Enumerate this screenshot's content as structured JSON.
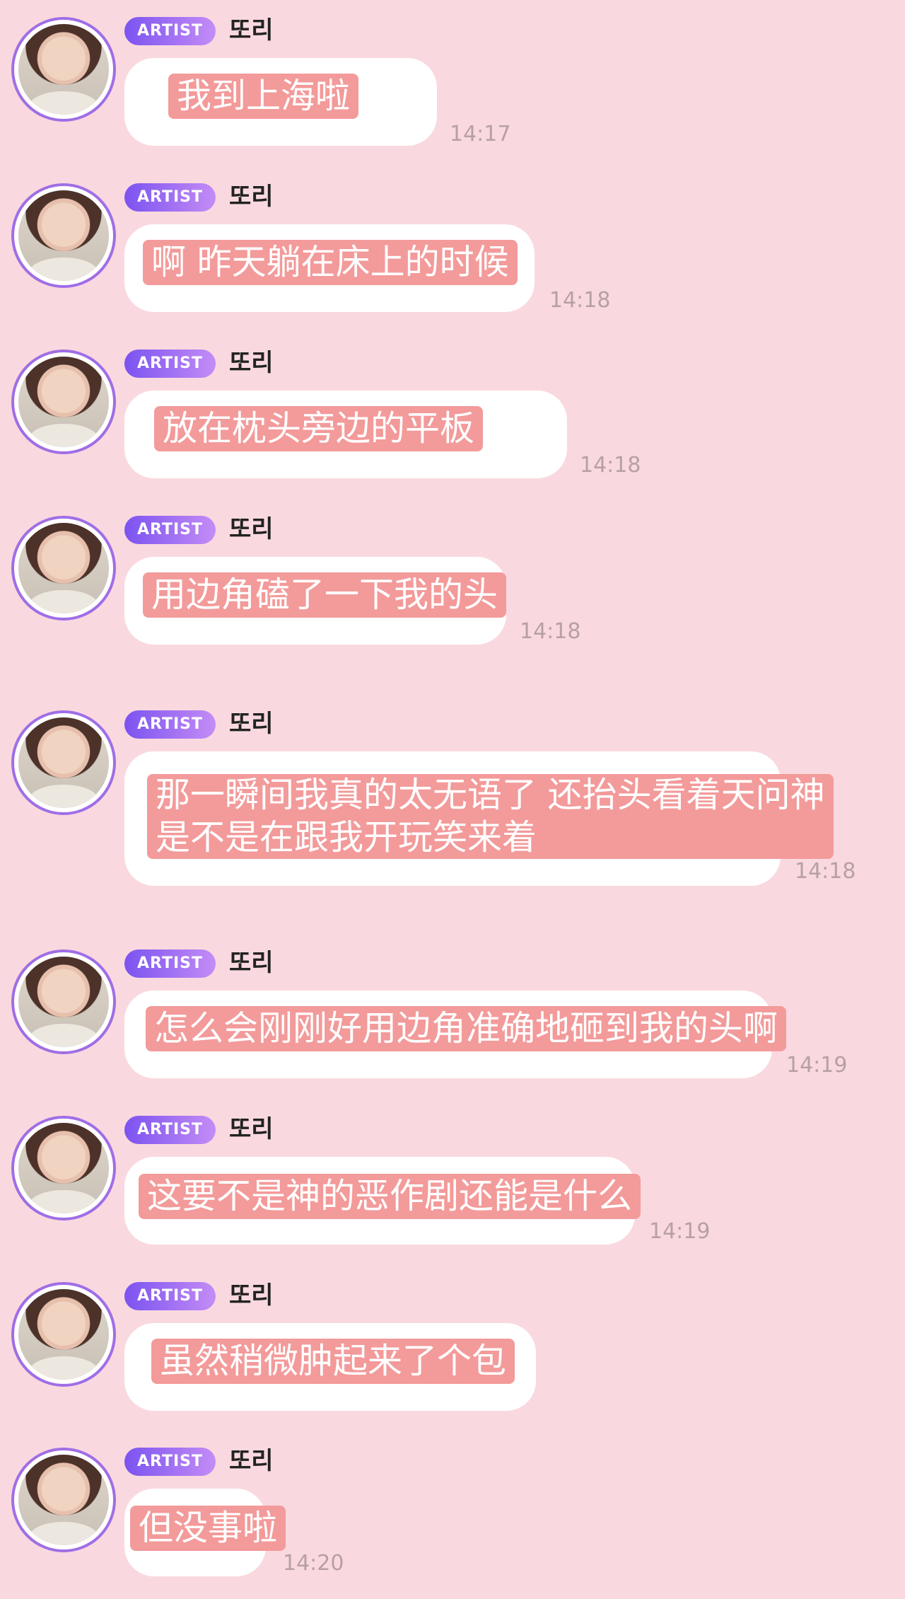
{
  "messages": [
    {
      "badge": "ARTIST",
      "sender": "또리",
      "caption": "我到上海啦",
      "time": "14:17"
    },
    {
      "badge": "ARTIST",
      "sender": "또리",
      "caption": "啊 昨天躺在床上的时候",
      "time": "14:18"
    },
    {
      "badge": "ARTIST",
      "sender": "또리",
      "caption": "放在枕头旁边的平板",
      "time": "14:18"
    },
    {
      "badge": "ARTIST",
      "sender": "또리",
      "caption": "用边角磕了一下我的头",
      "time": "14:18"
    },
    {
      "badge": "ARTIST",
      "sender": "또리",
      "caption_lines": [
        "那一瞬间我真的太无语了 还抬头看着天问神",
        "是不是在跟我开玩笑来着"
      ],
      "time": "14:18"
    },
    {
      "badge": "ARTIST",
      "sender": "또리",
      "caption": "怎么会刚刚好用边角准确地砸到我的头啊",
      "time": "14:19"
    },
    {
      "badge": "ARTIST",
      "sender": "또리",
      "caption": "这要不是神的恶作剧还能是什么",
      "time": "14:19"
    },
    {
      "badge": "ARTIST",
      "sender": "또리",
      "caption": "虽然稍微肿起来了个包",
      "time": ""
    },
    {
      "badge": "ARTIST",
      "sender": "또리",
      "caption": "但没事啦",
      "time": "14:20"
    }
  ],
  "colors": {
    "background": "#f9d9df",
    "caption": "#f39a9a",
    "badge": "#7b53f0",
    "ring": "#a06ee6"
  },
  "icons": {
    "avatar": "artist-avatar-photo"
  }
}
